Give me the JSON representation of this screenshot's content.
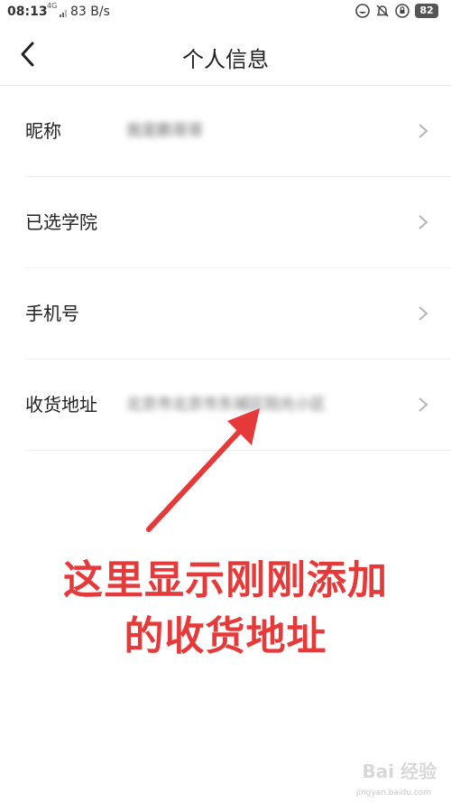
{
  "status_bar": {
    "time": "08:13",
    "network": "4G",
    "speed": "83 B/s",
    "battery": "82",
    "icons": [
      "face-icon",
      "bell-muted-icon",
      "lock-rotation-icon"
    ]
  },
  "header": {
    "title": "个人信息",
    "back_icon": "chevron-left-icon"
  },
  "rows": [
    {
      "label": "昵称",
      "value": "我是鹏哥哥",
      "value_blurred": true
    },
    {
      "label": "已选学院",
      "value": ""
    },
    {
      "label": "手机号",
      "value": ""
    },
    {
      "label": "收货地址",
      "value": "北京市北京市东城区阳光小区",
      "value_blurred": true
    }
  ],
  "annotation": {
    "line1": "这里显示刚刚添加",
    "line2": "的收货地址",
    "color": "#e63a3a"
  },
  "watermark": {
    "brand": "Bai 经验",
    "url": "jingyan.baidu.com"
  }
}
